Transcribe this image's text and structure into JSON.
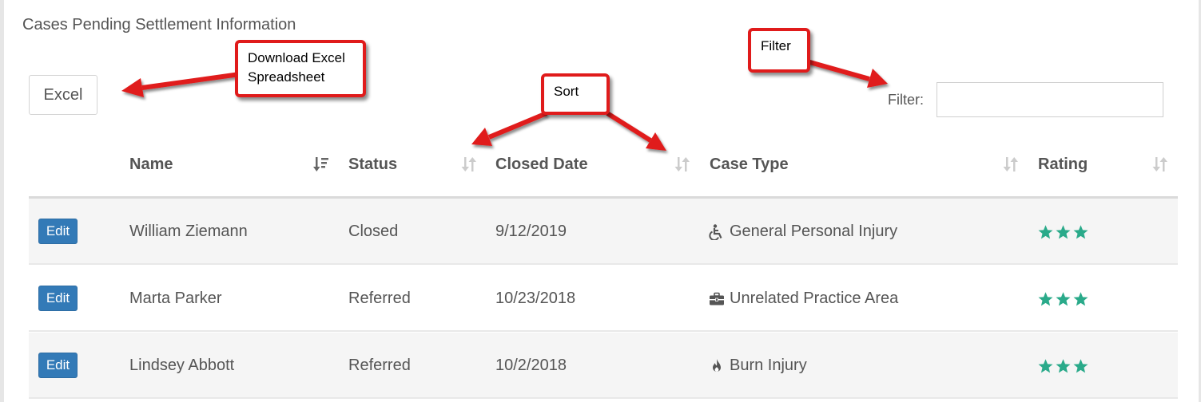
{
  "title": "Cases Pending Settlement Information",
  "excel_button": "Excel",
  "filter": {
    "label": "Filter:",
    "value": ""
  },
  "columns": [
    "Name",
    "Status",
    "Closed Date",
    "Case Type",
    "Rating"
  ],
  "rows": [
    {
      "edit": "Edit",
      "name": "William Ziemann",
      "status": "Closed",
      "closed_date": "9/12/2019",
      "case_type": "General Personal Injury",
      "case_icon": "wheelchair-icon",
      "rating": 3
    },
    {
      "edit": "Edit",
      "name": "Marta Parker",
      "status": "Referred",
      "closed_date": "10/23/2018",
      "case_type": "Unrelated Practice Area",
      "case_icon": "briefcase-icon",
      "rating": 3
    },
    {
      "edit": "Edit",
      "name": "Lindsey Abbott",
      "status": "Referred",
      "closed_date": "10/2/2018",
      "case_type": "Burn Injury",
      "case_icon": "fire-icon",
      "rating": 3
    }
  ],
  "callouts": {
    "download": [
      "Download Excel",
      "Spreadsheet"
    ],
    "sort": "Sort",
    "filter": "Filter"
  },
  "colors": {
    "edit_button": "#337ab7",
    "stars": "#2aaa8a",
    "callout_border": "#e01b1b"
  }
}
